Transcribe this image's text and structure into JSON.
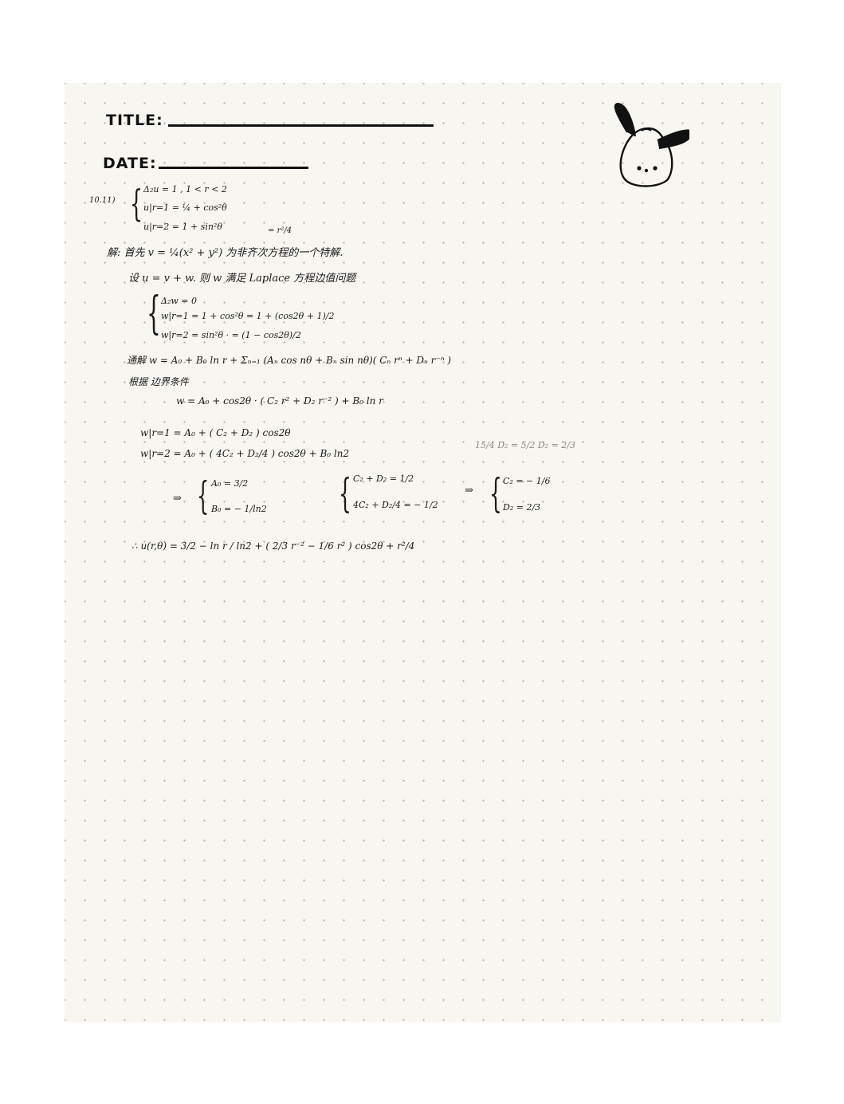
{
  "header": {
    "title_label": "TITLE:",
    "date_label": "DATE:"
  },
  "problem": {
    "number": "10.11)",
    "eq1": "Δ₂u = 1 ,   1 < r < 2",
    "eq2": "u|r=1 = ¼ + cos²θ",
    "eq3": "u|r=2 = 1 + sin²θ"
  },
  "solution": {
    "r2_over_4": "= r²/4",
    "line1": "解: 首先  v = ¼(x² + y²) 为非齐次方程的一个特解.",
    "line2": "设 u = v + w.  则 w 满足  Laplace 方程边值问题",
    "sys_w1": "Δ₂w = 0",
    "sys_w2": "w|r=1 = 1 + cos²θ  =  1 + (cos2θ + 1)/2",
    "sys_w3": "w|r=2 = sin²θ ·  =  (1 − cos2θ)/2",
    "general": "通解  w = A₀ + B₀ ln r + Σₙ₌₁ (Aₙ cos nθ + Bₙ sin nθ)( Cₙ rⁿ + Dₙ r⁻ⁿ )",
    "boundary_label": "根据 边界条件",
    "w_form": "w = A₀ + cos2θ · ( C₂ r² + D₂ r⁻² ) + B₀ ln r",
    "w_r1": "w|r=1  =  A₀ + ( C₂ + D₂ ) cos2θ",
    "w_r2": "w|r=2  =  A₀ + ( 4C₂ + D₂/4 ) cos2θ  + B₀ ln2",
    "side_note": "15/4 D₂ = 5/2     D₂ = 2/3",
    "arrow1": "⇒",
    "sol_A0": "A₀ = 3/2",
    "sol_B0": "B₀ = − 1/ln2",
    "sys_c1": "C₂ + D₂ = 1/2",
    "sys_c2": "4C₂ + D₂/4 = − 1/2",
    "arrow2": "⇒",
    "sol_C2": "C₂ = − 1/6",
    "sol_D2": "D₂ = 2/3",
    "final": "∴  u(r,θ) = 3/2 − ln r / ln2  + ( 2/3 r⁻² − 1/6 r² ) cos2θ  + r²/4"
  },
  "icons": {
    "mascot": "dog-doodle-icon"
  }
}
